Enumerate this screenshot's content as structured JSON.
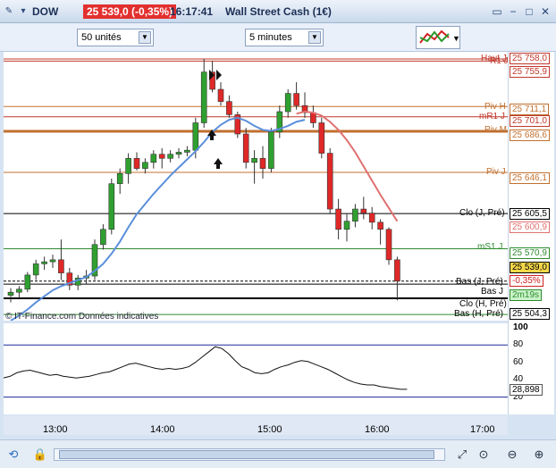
{
  "titlebar": {
    "symbol": "DOW",
    "price_change": "25 539,0 (-0,35%)",
    "time": "16:17:41",
    "instrument": "Wall Street Cash (1€)"
  },
  "toolbar": {
    "units_select": "50 unités",
    "interval_select": "5 minutes"
  },
  "price_axis": {
    "right_tags": [
      {
        "text": "25 758,0",
        "color": "#c0392b"
      },
      {
        "text": "25 755,9",
        "color": "#c0392b"
      },
      {
        "text": "25 711,1",
        "color": "#c07030"
      },
      {
        "text": "25 701,0",
        "color": "#c0392b"
      },
      {
        "text": "25 686,6",
        "color": "#c07030"
      },
      {
        "text": "25 646,1",
        "color": "#c07030"
      },
      {
        "text": "25 605,5",
        "color": "#000000"
      },
      {
        "text": "25 600,9",
        "color": "#e07070"
      },
      {
        "text": "25 570,9",
        "color": "#2e8b2e"
      },
      {
        "text": "25 539,0",
        "color": "#000000"
      },
      {
        "text": "-0,35%",
        "color": "#d02020"
      },
      {
        "text": "2m19s",
        "color": "#2e8b2e"
      },
      {
        "text": "25 504,3",
        "color": "#000000"
      }
    ],
    "line_labels": [
      "Haut J",
      "R1 J",
      "Piv H",
      "mR1 J",
      "Piv M",
      "Piv J",
      "Clo (J, Pré)",
      "mS1 J",
      "Bas (J, Pré)",
      "Bas J",
      "Clo (H, Pré)",
      "Bas (H, Pré)"
    ]
  },
  "indicator": {
    "ticks": [
      "100",
      "80",
      "60",
      "40",
      "20"
    ],
    "value": "28,898"
  },
  "time_axis": [
    "13:00",
    "14:00",
    "15:00",
    "16:00",
    "17:00"
  ],
  "credit": "© IT-Finance.com  Données indicatives",
  "colors": {
    "bull": "#2fa02f",
    "bear": "#e02828",
    "ma_fast": "#5b8fdc",
    "ma_slow": "#e07070"
  },
  "chart_data": {
    "type": "candlestick",
    "interval": "5 minutes",
    "ohlc": [
      [
        25525,
        25532,
        25518,
        25528
      ],
      [
        25528,
        25534,
        25522,
        25531
      ],
      [
        25531,
        25548,
        25528,
        25545
      ],
      [
        25545,
        25560,
        25540,
        25556
      ],
      [
        25556,
        25563,
        25550,
        25558
      ],
      [
        25558,
        25565,
        25552,
        25560
      ],
      [
        25560,
        25580,
        25540,
        25547
      ],
      [
        25547,
        25552,
        25530,
        25535
      ],
      [
        25535,
        25545,
        25530,
        25542
      ],
      [
        25542,
        25550,
        25536,
        25544
      ],
      [
        25544,
        25580,
        25540,
        25575
      ],
      [
        25575,
        25595,
        25570,
        25590
      ],
      [
        25590,
        25640,
        25585,
        25635
      ],
      [
        25635,
        25650,
        25625,
        25645
      ],
      [
        25645,
        25665,
        25635,
        25660
      ],
      [
        25660,
        25666,
        25648,
        25650
      ],
      [
        25650,
        25660,
        25645,
        25656
      ],
      [
        25656,
        25668,
        25650,
        25664
      ],
      [
        25664,
        25670,
        25650,
        25660
      ],
      [
        25660,
        25668,
        25656,
        25664
      ],
      [
        25664,
        25670,
        25660,
        25666
      ],
      [
        25666,
        25672,
        25662,
        25668
      ],
      [
        25668,
        25700,
        25660,
        25695
      ],
      [
        25695,
        25758,
        25690,
        25745
      ],
      [
        25745,
        25756,
        25725,
        25728
      ],
      [
        25728,
        25735,
        25712,
        25716
      ],
      [
        25716,
        25722,
        25700,
        25703
      ],
      [
        25703,
        25706,
        25680,
        25684
      ],
      [
        25684,
        25690,
        25650,
        25656
      ],
      [
        25656,
        25668,
        25635,
        25660
      ],
      [
        25660,
        25672,
        25640,
        25650
      ],
      [
        25650,
        25690,
        25646,
        25686
      ],
      [
        25686,
        25712,
        25680,
        25706
      ],
      [
        25706,
        25728,
        25700,
        25724
      ],
      [
        25724,
        25735,
        25708,
        25712
      ],
      [
        25712,
        25725,
        25700,
        25705
      ],
      [
        25705,
        25712,
        25690,
        25695
      ],
      [
        25695,
        25700,
        25660,
        25665
      ],
      [
        25665,
        25670,
        25605,
        25610
      ],
      [
        25610,
        25620,
        25580,
        25590
      ],
      [
        25590,
        25605,
        25578,
        25598
      ],
      [
        25598,
        25615,
        25592,
        25610
      ],
      [
        25610,
        25622,
        25600,
        25606
      ],
      [
        25606,
        25612,
        25590,
        25597
      ],
      [
        25597,
        25600,
        25575,
        25590
      ],
      [
        25590,
        25592,
        25555,
        25560
      ],
      [
        25560,
        25563,
        25520,
        25539
      ]
    ],
    "ylim": [
      25500,
      25765
    ],
    "x_ticks": [
      "13:00",
      "14:00",
      "15:00",
      "16:00",
      "17:00"
    ]
  }
}
